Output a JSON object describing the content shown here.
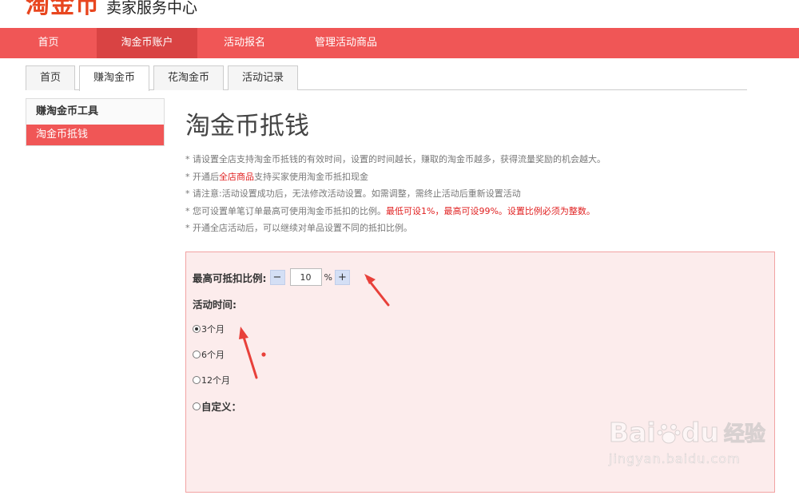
{
  "header": {
    "logo_main": "淘金币",
    "logo_sub": "卖家服务中心"
  },
  "topnav": [
    "首页",
    "淘金币账户",
    "活动报名",
    "管理活动商品"
  ],
  "tabs": [
    "首页",
    "赚淘金币",
    "花淘金币",
    "活动记录"
  ],
  "sidebar": {
    "title": "赚淘金币工具",
    "item": "淘金币抵钱"
  },
  "page_title": "淘金币抵钱",
  "notes": {
    "n1": "* 请设置全店支持淘金币抵钱的有效时间，设置的时间越长，赚取的淘金币越多，获得流量奖励的机会越大。",
    "n2_a": "* 开通后",
    "n2_b": "全店商品",
    "n2_c": "支持买家使用淘金币抵扣现金",
    "n3": "* 请注意:活动设置成功后，无法修改活动设置。如需调整，需终止活动后重新设置活动",
    "n4_a": "* 您可设置单笔订单最高可使用淘金币抵扣的比例。",
    "n4_b": "最低可设1%，最高可设99%。设置比例必须为整数。",
    "n5": "* 开通全店活动后，可以继续对单品设置不同的抵扣比例。"
  },
  "form": {
    "ratio_label": "最高可抵扣比例:",
    "minus": "−",
    "plus": "+",
    "ratio_value": "10",
    "percent": "%",
    "time_label": "活动时间:",
    "options": [
      "3个月",
      "6个月",
      "12个月"
    ],
    "custom": "自定义："
  },
  "watermark": {
    "brand_a": "Bai",
    "brand_b": "du",
    "brand_c": "经验",
    "url": "jingyan.baidu.com"
  },
  "colors": {
    "accent": "#f05656",
    "panel_bg": "#fcecec",
    "logo": "#e8461f",
    "highlight": "#e02020"
  }
}
